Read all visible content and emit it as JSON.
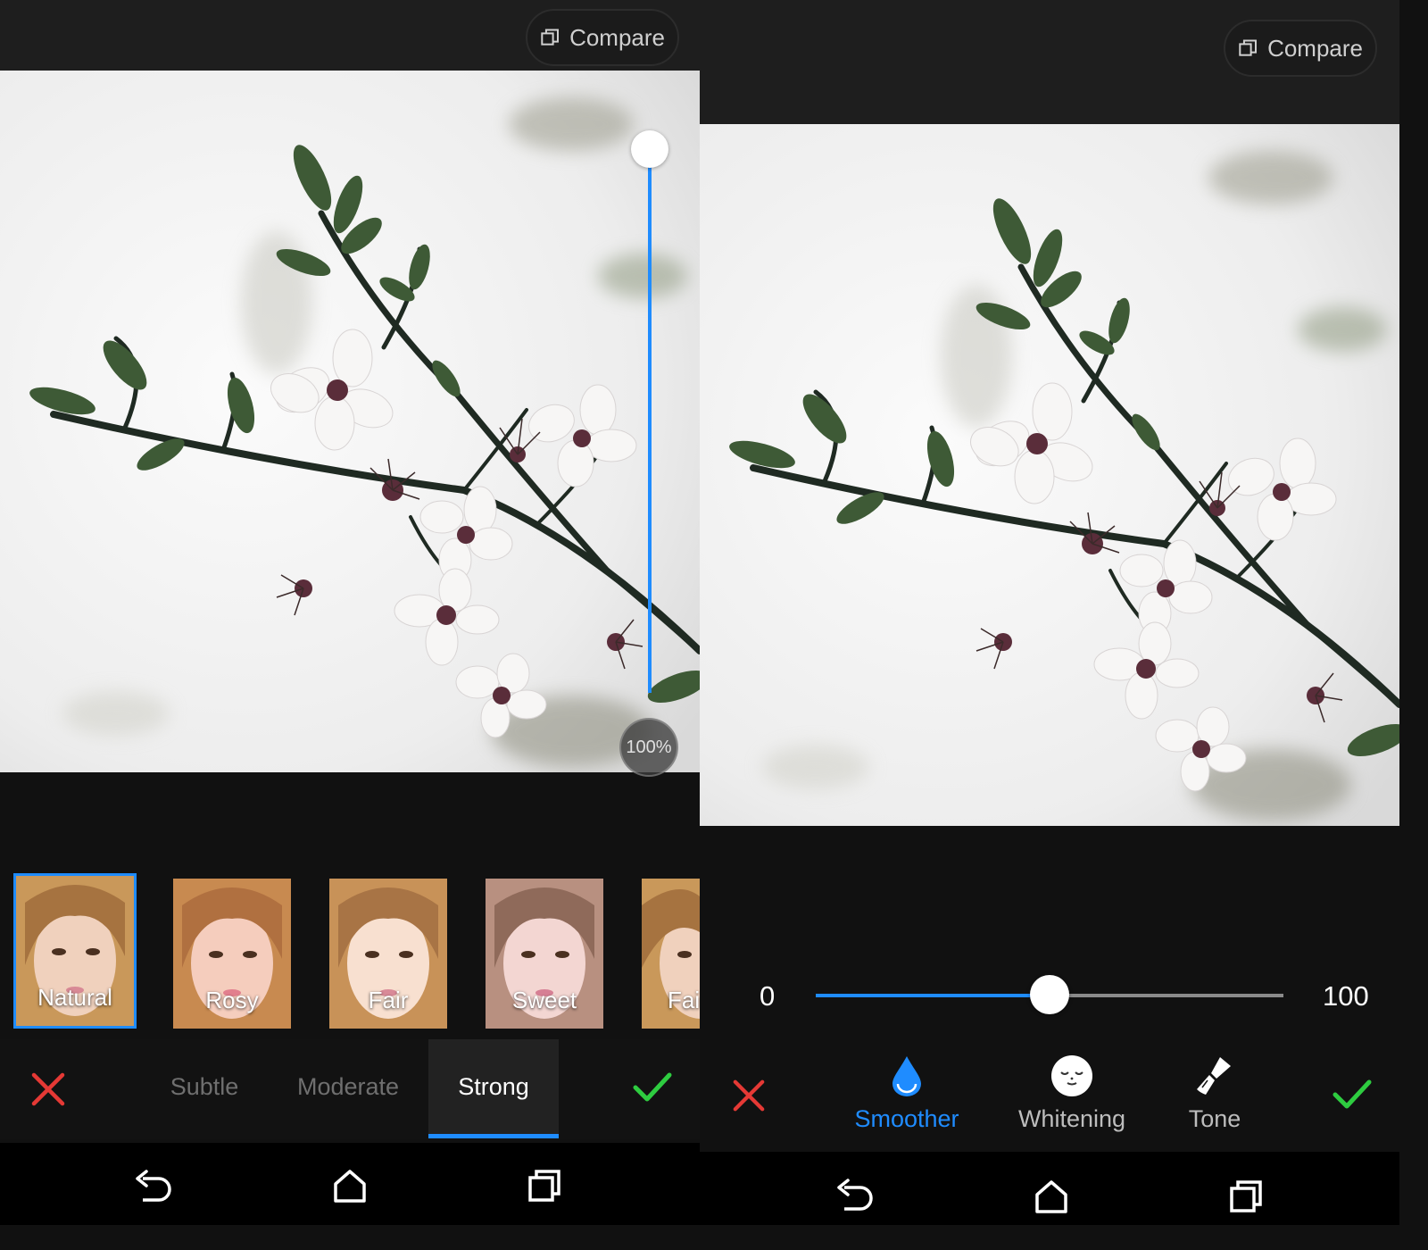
{
  "left_screen": {
    "compare_label": "Compare",
    "vertical_slider_percent": 100,
    "strength_badge": "100%",
    "filters": [
      {
        "label": "Natural",
        "selected": true
      },
      {
        "label": "Rosy",
        "selected": false
      },
      {
        "label": "Fair",
        "selected": false
      },
      {
        "label": "Sweet",
        "selected": false
      },
      {
        "label": "Fai",
        "selected": false
      }
    ],
    "strength_tabs": [
      {
        "label": "Subtle",
        "active": false
      },
      {
        "label": "Moderate",
        "active": false
      },
      {
        "label": "Strong",
        "active": true
      }
    ]
  },
  "right_screen": {
    "compare_label": "Compare",
    "slider": {
      "min_label": "0",
      "max_label": "100",
      "value_fraction": 0.5
    },
    "tools": [
      {
        "label": "Smoother",
        "icon": "water-drop-icon",
        "active": true
      },
      {
        "label": "Whitening",
        "icon": "face-mask-icon",
        "active": false
      },
      {
        "label": "Tone",
        "icon": "brush-icon",
        "active": false
      }
    ]
  },
  "colors": {
    "accent": "#1f8cff",
    "cancel": "#e53935",
    "confirm": "#2ecc40",
    "background": "#111111"
  },
  "nav_icons": [
    "back-icon",
    "home-icon",
    "recents-icon"
  ]
}
